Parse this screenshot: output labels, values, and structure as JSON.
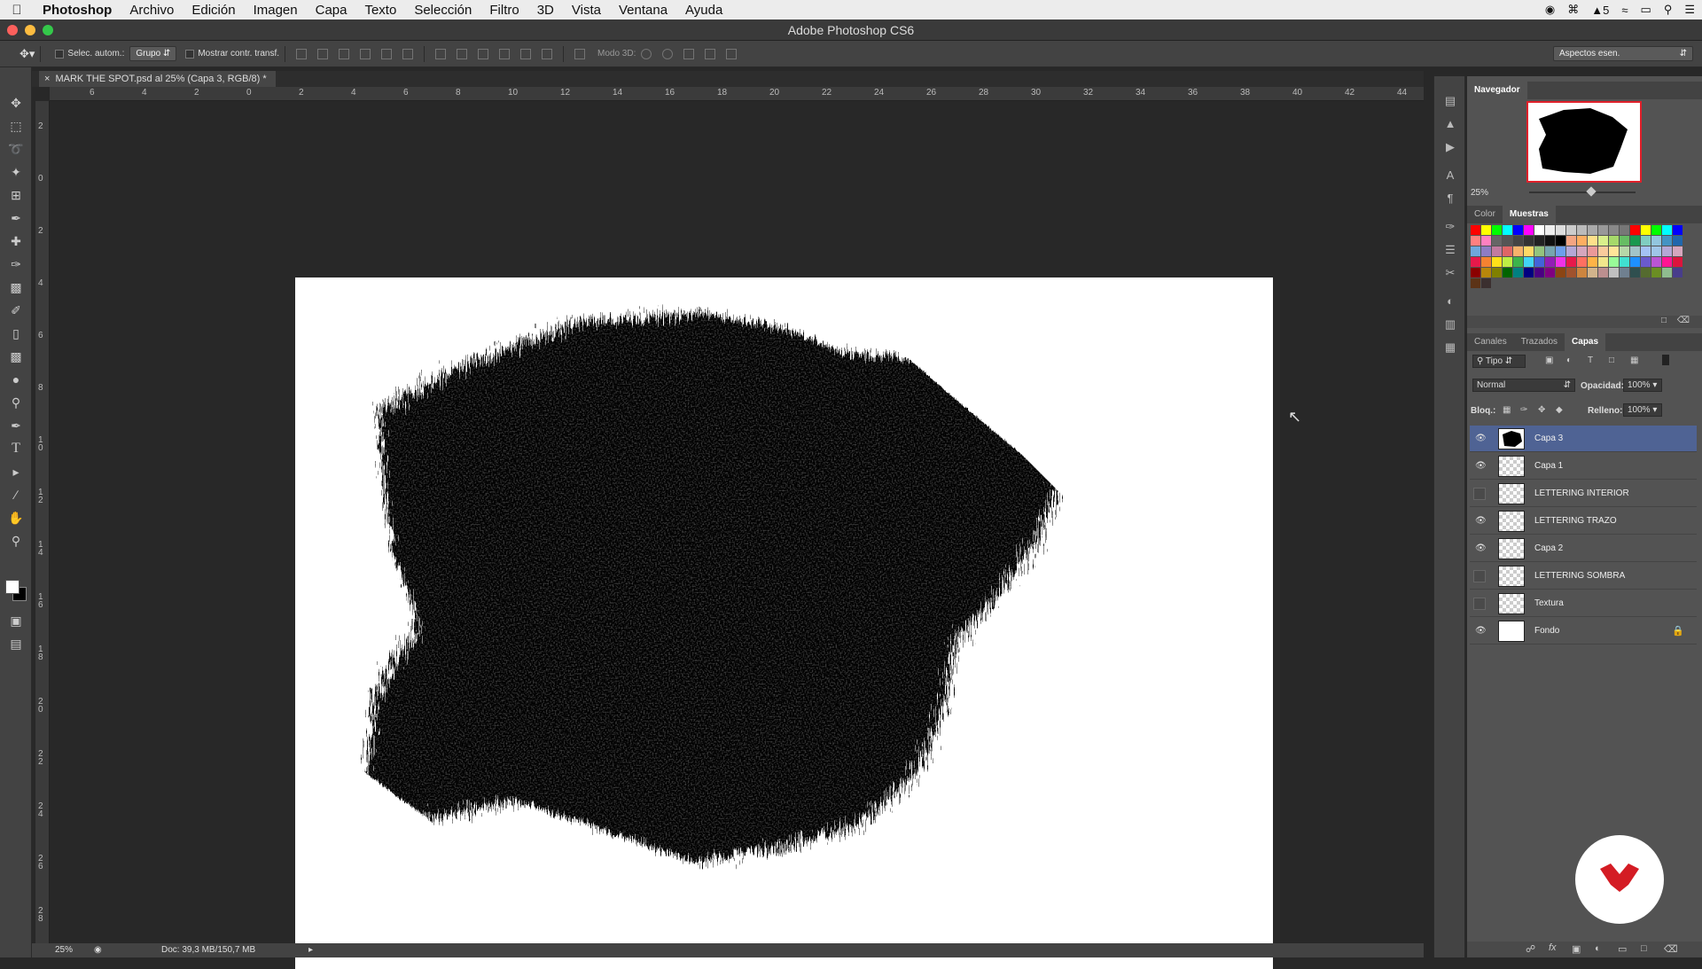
{
  "menubar": {
    "app": "Photoshop",
    "items": [
      "Archivo",
      "Edición",
      "Imagen",
      "Capa",
      "Texto",
      "Selección",
      "Filtro",
      "3D",
      "Vista",
      "Ventana",
      "Ayuda"
    ],
    "status_num": "5"
  },
  "window": {
    "title": "Adobe Photoshop CS6"
  },
  "options": {
    "auto_select_label": "Selec. autom.:",
    "auto_select_value": "Grupo",
    "show_transform_label": "Mostrar contr. transf.",
    "mode3d_label": "Modo 3D:",
    "workspace": "Aspectos esen."
  },
  "document": {
    "tab_title": "MARK THE SPOT.psd al 25% (Capa 3, RGB/8) *",
    "ruler_h": [
      "6",
      "4",
      "2",
      "0",
      "2",
      "4",
      "6",
      "8",
      "10",
      "12",
      "14",
      "16",
      "18",
      "20",
      "22",
      "24",
      "26",
      "28",
      "30",
      "32",
      "34",
      "36",
      "38",
      "40",
      "42",
      "44"
    ],
    "ruler_v": [
      "2",
      "0",
      "2",
      "4",
      "6",
      "8",
      "1 0",
      "1 2",
      "1 4",
      "1 6",
      "1 8",
      "2 0",
      "2 2",
      "2 4",
      "2 6",
      "2 8"
    ]
  },
  "status": {
    "zoom": "25%",
    "doc": "Doc: 39,3 MB/150,7 MB"
  },
  "navigator": {
    "title": "Navegador",
    "zoom": "25%"
  },
  "swatches": {
    "tabs": [
      "Color",
      "Muestras"
    ],
    "colors": [
      "#ff0000",
      "#ffff00",
      "#00ff00",
      "#00ffff",
      "#0000ff",
      "#ff00ff",
      "#ffffff",
      "#eeeeee",
      "#dddddd",
      "#cccccc",
      "#bbbbbb",
      "#aaaaaa",
      "#999999",
      "#888888",
      "#777777",
      "#ff0000",
      "#ffff00",
      "#00ff00",
      "#00ffff",
      "#0000ff",
      "#ff8080",
      "#ff80c0",
      "#666666",
      "#555555",
      "#444444",
      "#333333",
      "#222222",
      "#111111",
      "#000000",
      "#f4a582",
      "#fdae61",
      "#fee08b",
      "#d9ef8b",
      "#a6d96a",
      "#66bd63",
      "#1a9850",
      "#80cdc1",
      "#92c5de",
      "#4393c3",
      "#2166ac",
      "#6fa8dc",
      "#8e7cc3",
      "#c27ba0",
      "#e06666",
      "#f6b26b",
      "#ffd966",
      "#93c47d",
      "#76a5af",
      "#6d9eeb",
      "#b4a7d6",
      "#d5a6bd",
      "#ea9999",
      "#f9cb9c",
      "#ffe599",
      "#b6d7a8",
      "#a2c4c9",
      "#a4c2f4",
      "#9fc5e8",
      "#b4a7d6",
      "#d5a6bd",
      "#e6194b",
      "#f58231",
      "#ffe119",
      "#bfef45",
      "#3cb44b",
      "#42d4f4",
      "#4363d8",
      "#911eb4",
      "#f032e6",
      "#e6194b",
      "#ff6f61",
      "#ffb347",
      "#f0e68c",
      "#98fb98",
      "#40e0d0",
      "#1e90ff",
      "#6a5acd",
      "#ba55d3",
      "#ff1493",
      "#dc143c",
      "#8b0000",
      "#b8860b",
      "#808000",
      "#006400",
      "#008080",
      "#000080",
      "#4b0082",
      "#800080",
      "#8b4513",
      "#a0522d",
      "#cd853f",
      "#d2b48c",
      "#bc8f8f",
      "#c0c0c0",
      "#708090",
      "#2f4f4f",
      "#556b2f",
      "#6b8e23",
      "#8fbc8f",
      "#483d8b",
      "#5c3317",
      "#3b2f2f"
    ]
  },
  "layers": {
    "tabs": [
      "Canales",
      "Trazados",
      "Capas"
    ],
    "filter": "Tipo",
    "blend": "Normal",
    "opacity_label": "Opacidad:",
    "opacity": "100%",
    "lock_label": "Bloq.:",
    "fill_label": "Relleno:",
    "fill": "100%",
    "items": [
      {
        "name": "Capa 3",
        "visible": true,
        "selected": true
      },
      {
        "name": "Capa 1",
        "visible": true
      },
      {
        "name": "LETTERING INTERIOR",
        "visible": false
      },
      {
        "name": "LETTERING TRAZO",
        "visible": true
      },
      {
        "name": "Capa 2",
        "visible": true
      },
      {
        "name": "LETTERING SOMBRA",
        "visible": false
      },
      {
        "name": "Textura",
        "visible": false
      },
      {
        "name": "Fondo",
        "visible": true,
        "locked": true
      }
    ]
  }
}
